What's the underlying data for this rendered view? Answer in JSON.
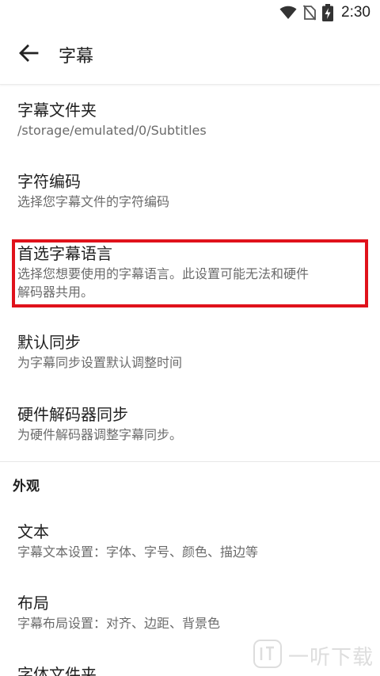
{
  "status_bar": {
    "time": "2:30",
    "icons": [
      "wifi-icon",
      "no-sim-icon",
      "battery-charging-icon"
    ]
  },
  "app_bar": {
    "title": "字幕",
    "back_icon": "arrow-back-icon"
  },
  "items": [
    {
      "title": "字幕文件夹",
      "summary": "/storage/emulated/0/Subtitles"
    },
    {
      "title": "字符编码",
      "summary": "选择您字幕文件的字符编码"
    },
    {
      "title": "首选字幕语言",
      "summary_line1": "选择您想要使用的字幕语言。此设置可能无法和硬件",
      "summary_line2": "解码器共用。",
      "highlighted": true,
      "highlight_color": "#e0121b"
    },
    {
      "title": "默认同步",
      "summary": "为字幕同步设置默认调整时间"
    },
    {
      "title": "硬件解码器同步",
      "summary": "为硬件解码器调整字幕同步。"
    }
  ],
  "section": {
    "header": "外观",
    "items": [
      {
        "title": "文本",
        "summary": "字幕文本设置：字体、字号、颜色、描边等"
      },
      {
        "title": "布局",
        "summary": "字幕布局设置：对齐、边距、背景色"
      },
      {
        "title": "字体文件夹"
      }
    ]
  },
  "watermark": {
    "text": "一听下载"
  }
}
